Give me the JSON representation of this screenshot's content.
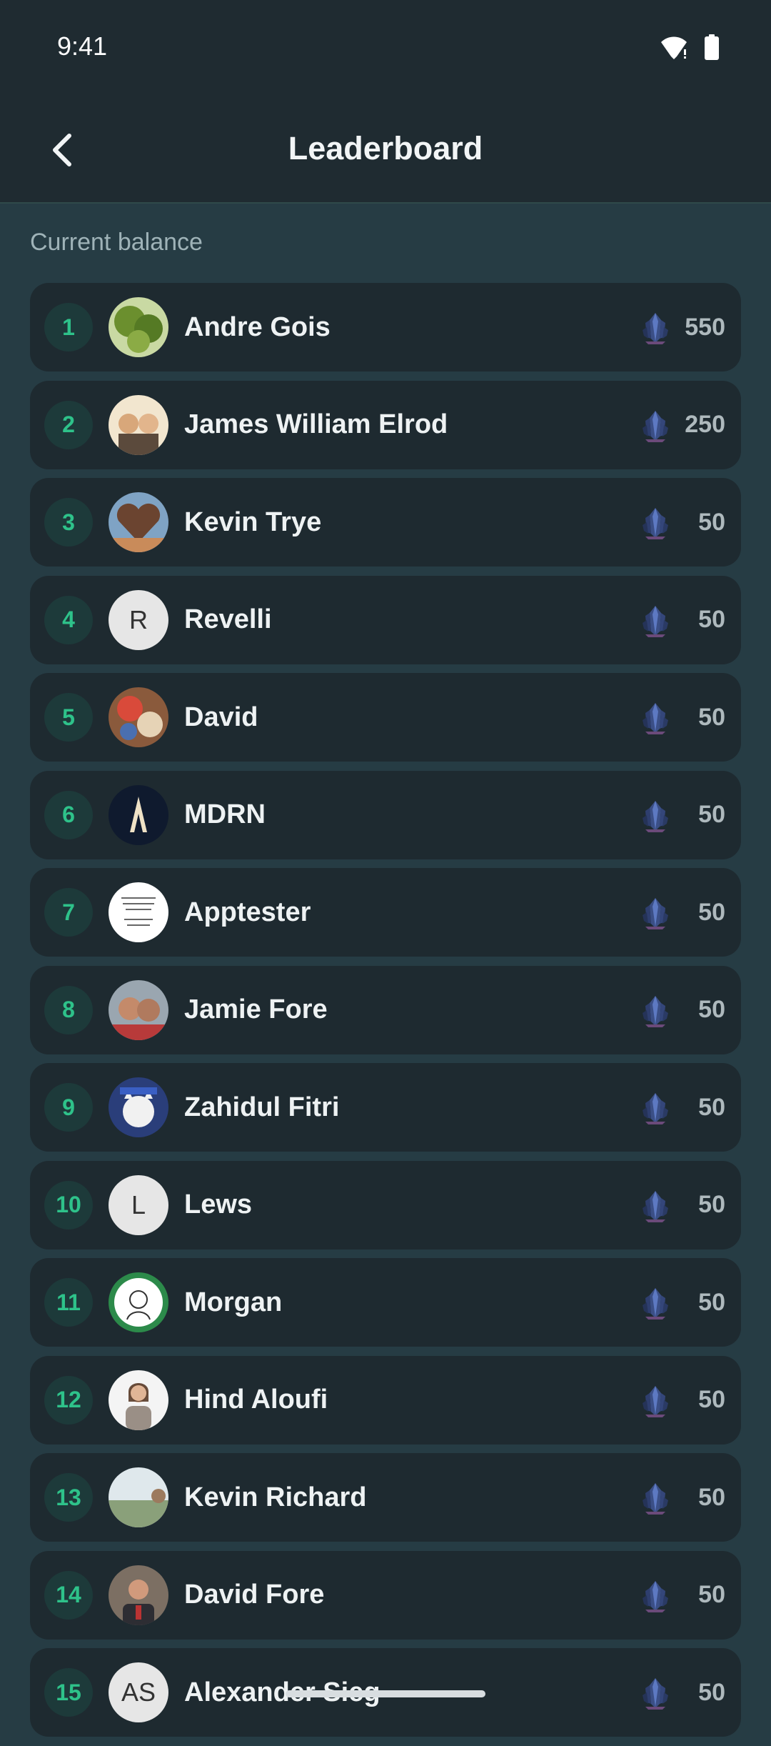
{
  "status_bar": {
    "time": "9:41"
  },
  "header": {
    "title": "Leaderboard"
  },
  "section": {
    "label": "Current balance"
  },
  "entries": [
    {
      "rank": "1",
      "name": "Andre Gois",
      "score": "550",
      "avatar": "photo-green"
    },
    {
      "rank": "2",
      "name": "James William Elrod",
      "score": "250",
      "avatar": "photo-cartoon"
    },
    {
      "rank": "3",
      "name": "Kevin Trye",
      "score": "50",
      "avatar": "photo-heart"
    },
    {
      "rank": "4",
      "name": "Revelli",
      "score": "50",
      "avatar": "letter",
      "letter": "R"
    },
    {
      "rank": "5",
      "name": "David",
      "score": "50",
      "avatar": "photo-food"
    },
    {
      "rank": "6",
      "name": "MDRN",
      "score": "50",
      "avatar": "logo-mdrn"
    },
    {
      "rank": "7",
      "name": "Apptester",
      "score": "50",
      "avatar": "photo-text"
    },
    {
      "rank": "8",
      "name": "Jamie Fore",
      "score": "50",
      "avatar": "photo-couple"
    },
    {
      "rank": "9",
      "name": "Zahidul Fitri",
      "score": "50",
      "avatar": "photo-cat"
    },
    {
      "rank": "10",
      "name": "Lews",
      "score": "50",
      "avatar": "letter",
      "letter": "L"
    },
    {
      "rank": "11",
      "name": "Morgan",
      "score": "50",
      "avatar": "photo-sketch"
    },
    {
      "rank": "12",
      "name": "Hind Aloufi",
      "score": "50",
      "avatar": "photo-woman"
    },
    {
      "rank": "13",
      "name": "Kevin Richard",
      "score": "50",
      "avatar": "photo-landscape"
    },
    {
      "rank": "14",
      "name": "David Fore",
      "score": "50",
      "avatar": "photo-man"
    },
    {
      "rank": "15",
      "name": "Alexander Sieg",
      "score": "50",
      "avatar": "letter",
      "letter": "AS"
    }
  ],
  "colors": {
    "background": "#263c44",
    "header_bg": "#1f2b31",
    "row_bg": "#1e2a30",
    "rank_text": "#2ec28a",
    "rank_bg": "#1d3a3a"
  },
  "icons": {
    "back": "chevron-left-icon",
    "currency": "crystal-gem-icon",
    "wifi": "wifi-icon",
    "battery": "battery-icon"
  }
}
